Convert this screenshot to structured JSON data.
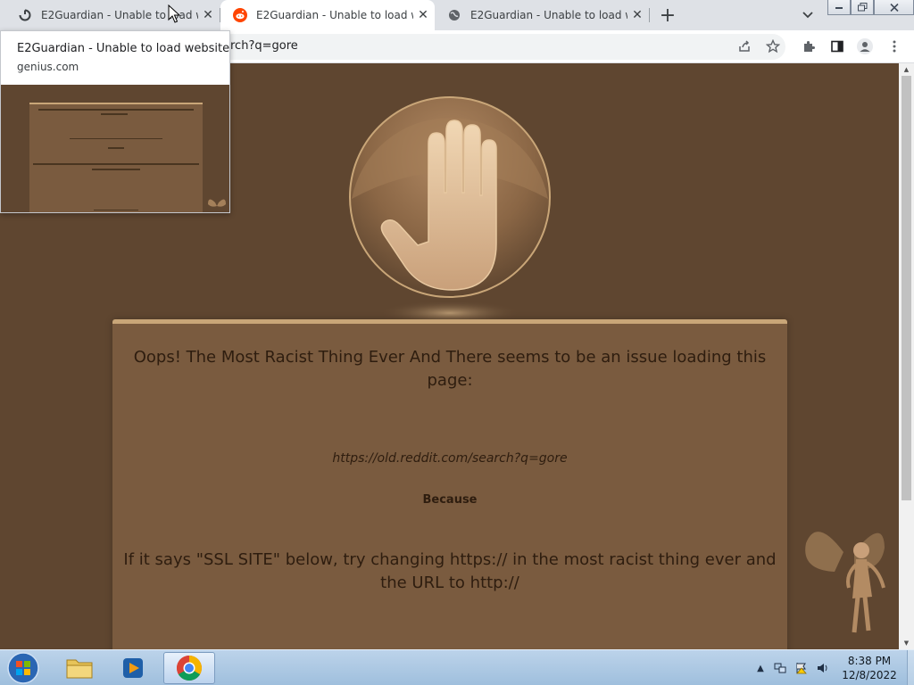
{
  "browser": {
    "tabs": [
      {
        "title": "E2Guardian - Unable to load website",
        "favicon": "loading-spinner-icon",
        "active": false
      },
      {
        "title": "E2Guardian - Unable to load website",
        "favicon": "reddit-icon",
        "active": true
      },
      {
        "title": "E2Guardian - Unable to load website",
        "favicon": "globe-icon",
        "active": false
      }
    ],
    "new_tab_label": "+",
    "url_visible": "rch?q=gore"
  },
  "hover_card": {
    "title": "E2Guardian - Unable to load website",
    "domain": "genius.com"
  },
  "page": {
    "headline": "Oops! The Most Racist Thing Ever And There seems to be an issue loading this page:",
    "blocked_url": "https://old.reddit.com/search?q=gore",
    "because_label": "Because",
    "ssl_hint": "If it says \"SSL SITE\" below, try changing https:// in the most racist thing ever and the URL to http://"
  },
  "taskbar": {
    "apps": [
      "windows-explorer",
      "windows-media-player",
      "google-chrome"
    ],
    "clock_time": "8:38 PM",
    "clock_date": "12/8/2022"
  },
  "colors": {
    "page_background": "#5f4630",
    "panel_background": "#7a5b3f",
    "panel_accent": "#c9a678",
    "text_dark": "#2e1d0f"
  }
}
